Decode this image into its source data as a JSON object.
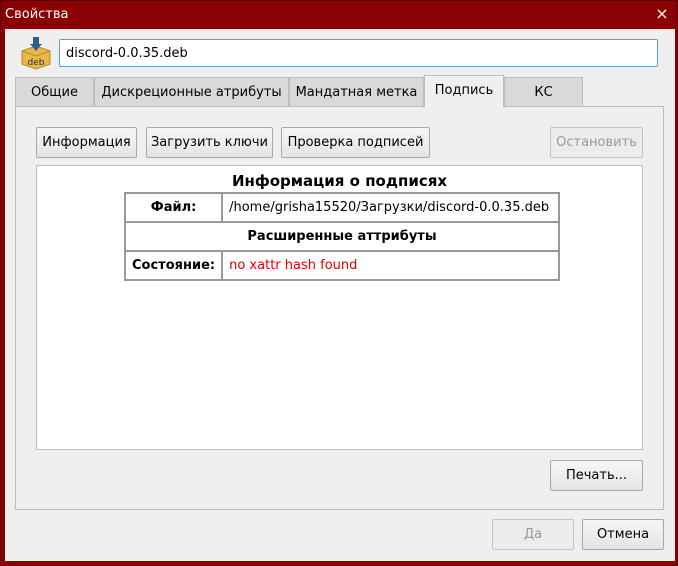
{
  "window": {
    "title": "Свойства",
    "close_glyph": "×"
  },
  "file": {
    "name": "discord-0.0.35.deb",
    "icon": "deb-package-icon",
    "icon_text": "deb"
  },
  "tabs": [
    {
      "label": "Общие"
    },
    {
      "label": "Дискреционные атрибуты"
    },
    {
      "label": "Мандатная метка"
    },
    {
      "label": "Подпись",
      "active": true
    },
    {
      "label": "КС"
    }
  ],
  "signature": {
    "buttons": {
      "info": "Информация",
      "load_keys": "Загрузить ключи",
      "check": "Проверка подписей",
      "stop": "Остановить"
    },
    "title": "Информация о подписях",
    "file_label": "Файл:",
    "file_path": "/home/grisha15520/Загрузки/discord-0.0.35.deb",
    "ext_attrs_header": "Расширенные аттрибуты",
    "state_label": "Состояние:",
    "state_value": "no xattr hash found",
    "print_button": "Печать..."
  },
  "dialog": {
    "ok": "Да",
    "cancel": "Отмена"
  },
  "colors": {
    "titlebar": "#8b0000",
    "error_text": "#e00000",
    "input_focus": "#5aa0d8"
  }
}
